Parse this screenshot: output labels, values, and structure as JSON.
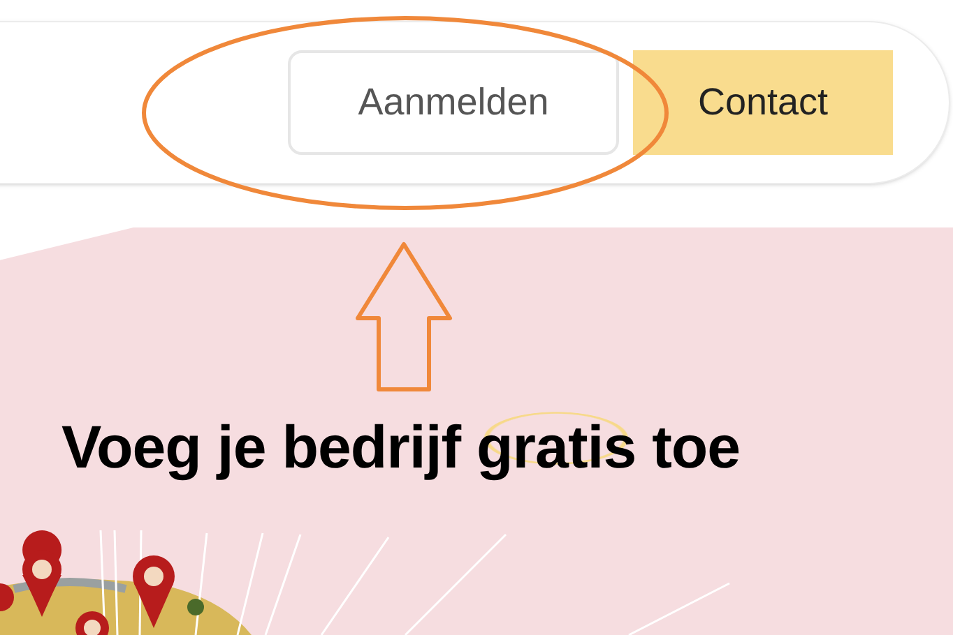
{
  "header": {
    "buttons": [
      {
        "label": "Aanmelden",
        "kind": "outline"
      },
      {
        "label": "Contact",
        "kind": "filled"
      }
    ]
  },
  "hero": {
    "headline": "Voeg je bedrijf gratis toe"
  }
}
